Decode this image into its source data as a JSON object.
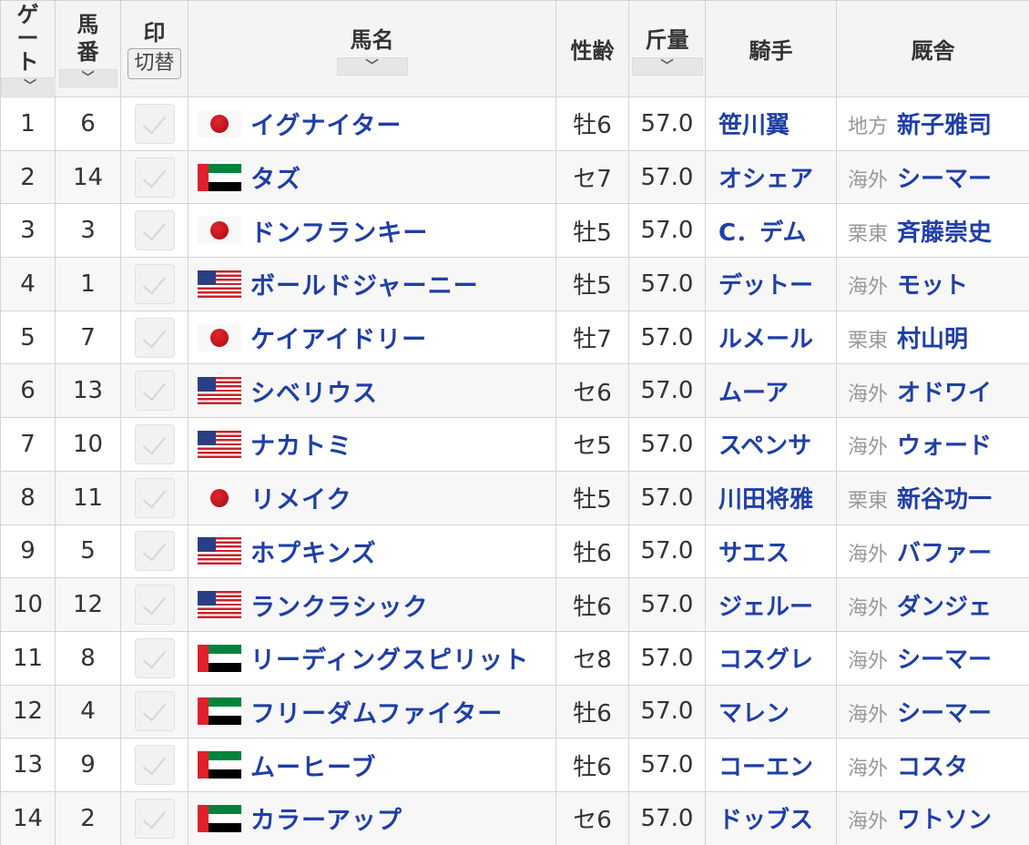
{
  "header": {
    "gate_chars": [
      "ゲ",
      "ー",
      "ト"
    ],
    "num_chars": [
      "馬",
      "番"
    ],
    "mark": "印",
    "mark_toggle": "切替",
    "horse": "馬名",
    "sex_age": "性齢",
    "weight": "斤量",
    "jockey": "騎手",
    "stable": "厩舎",
    "sort_icon": "chevron-down-icon",
    "sort_glyph": "﹀"
  },
  "flag_colors": {
    "jp_sun": "#e2262e",
    "us_blue": "#2b3e84",
    "us_red": "#c8232c",
    "ae_green": "#00843d",
    "ae_red": "#e0202a",
    "ae_black": "#000000"
  },
  "link_color": "#1f3fa8",
  "rows": [
    {
      "gate": "1",
      "num": "6",
      "flag": "jp",
      "horse": "イグナイター",
      "sex_age": "牡6",
      "weight": "57.0",
      "jockey": "笹川翼",
      "region": "地方",
      "trainer": "新子雅司"
    },
    {
      "gate": "2",
      "num": "14",
      "flag": "ae",
      "horse": "タズ",
      "sex_age": "セ7",
      "weight": "57.0",
      "jockey": "オシェア",
      "region": "海外",
      "trainer": "シーマー"
    },
    {
      "gate": "3",
      "num": "3",
      "flag": "jp",
      "horse": "ドンフランキー",
      "sex_age": "牡5",
      "weight": "57.0",
      "jockey": "C．デム",
      "region": "栗東",
      "trainer": "斉藤崇史"
    },
    {
      "gate": "4",
      "num": "1",
      "flag": "us",
      "horse": "ボールドジャーニー",
      "sex_age": "牡5",
      "weight": "57.0",
      "jockey": "デットー",
      "region": "海外",
      "trainer": "モット"
    },
    {
      "gate": "5",
      "num": "7",
      "flag": "jp",
      "horse": "ケイアイドリー",
      "sex_age": "牡7",
      "weight": "57.0",
      "jockey": "ルメール",
      "region": "栗東",
      "trainer": "村山明"
    },
    {
      "gate": "6",
      "num": "13",
      "flag": "us",
      "horse": "シベリウス",
      "sex_age": "セ6",
      "weight": "57.0",
      "jockey": "ムーア",
      "region": "海外",
      "trainer": "オドワイ"
    },
    {
      "gate": "7",
      "num": "10",
      "flag": "us",
      "horse": "ナカトミ",
      "sex_age": "セ5",
      "weight": "57.0",
      "jockey": "スペンサ",
      "region": "海外",
      "trainer": "ウォード"
    },
    {
      "gate": "8",
      "num": "11",
      "flag": "jp",
      "horse": "リメイク",
      "sex_age": "牡5",
      "weight": "57.0",
      "jockey": "川田将雅",
      "region": "栗東",
      "trainer": "新谷功一"
    },
    {
      "gate": "9",
      "num": "5",
      "flag": "us",
      "horse": "ホプキンズ",
      "sex_age": "牡6",
      "weight": "57.0",
      "jockey": "サエス",
      "region": "海外",
      "trainer": "バファー"
    },
    {
      "gate": "10",
      "num": "12",
      "flag": "us",
      "horse": "ランクラシック",
      "sex_age": "牡6",
      "weight": "57.0",
      "jockey": "ジェルー",
      "region": "海外",
      "trainer": "ダンジェ"
    },
    {
      "gate": "11",
      "num": "8",
      "flag": "ae",
      "horse": "リーディングスピリット",
      "sex_age": "セ8",
      "weight": "57.0",
      "jockey": "コスグレ",
      "region": "海外",
      "trainer": "シーマー"
    },
    {
      "gate": "12",
      "num": "4",
      "flag": "ae",
      "horse": "フリーダムファイター",
      "sex_age": "牡6",
      "weight": "57.0",
      "jockey": "マレン",
      "region": "海外",
      "trainer": "シーマー"
    },
    {
      "gate": "13",
      "num": "9",
      "flag": "ae",
      "horse": "ムーヒーブ",
      "sex_age": "牡6",
      "weight": "57.0",
      "jockey": "コーエン",
      "region": "海外",
      "trainer": "コスタ"
    },
    {
      "gate": "14",
      "num": "2",
      "flag": "ae",
      "horse": "カラーアップ",
      "sex_age": "セ6",
      "weight": "57.0",
      "jockey": "ドッブス",
      "region": "海外",
      "trainer": "ワトソン"
    }
  ]
}
